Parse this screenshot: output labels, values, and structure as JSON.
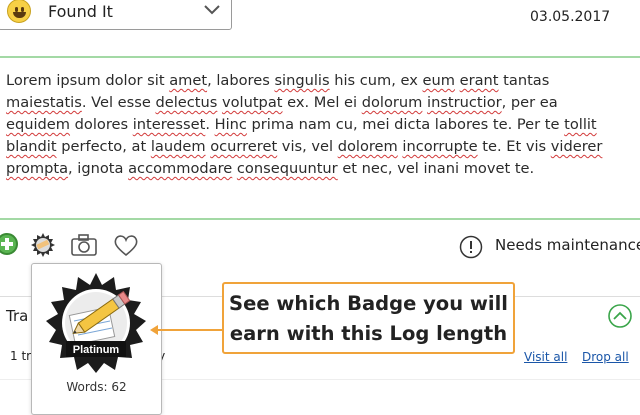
{
  "log_type": {
    "label": "Found It",
    "icon": "smiley-face-icon"
  },
  "date": "03.05.2017",
  "editor": {
    "segments": [
      {
        "t": "Lorem ipsum dolor sit ",
        "sp": false
      },
      {
        "t": "amet",
        "sp": true
      },
      {
        "t": ", labores ",
        "sp": false
      },
      {
        "t": "singulis",
        "sp": true
      },
      {
        "t": " his cum, ex ",
        "sp": false
      },
      {
        "t": "eum",
        "sp": true
      },
      {
        "t": " ",
        "sp": false
      },
      {
        "t": "erant",
        "sp": true
      },
      {
        "t": " tantas ",
        "sp": false
      },
      {
        "t": "maiestatis",
        "sp": true
      },
      {
        "t": ". Vel esse ",
        "sp": false
      },
      {
        "t": "delectus",
        "sp": true
      },
      {
        "t": " ",
        "sp": false
      },
      {
        "t": "volutpat",
        "sp": true
      },
      {
        "t": " ex. Mel ei ",
        "sp": false
      },
      {
        "t": "dolorum",
        "sp": true
      },
      {
        "t": " ",
        "sp": false
      },
      {
        "t": "instructior",
        "sp": true
      },
      {
        "t": ", per ea ",
        "sp": false
      },
      {
        "t": "equidem",
        "sp": true
      },
      {
        "t": " dolores ",
        "sp": false
      },
      {
        "t": "interesset",
        "sp": true
      },
      {
        "t": ". ",
        "sp": false
      },
      {
        "t": "Hinc",
        "sp": true
      },
      {
        "t": " prima nam cu, mei dicta labores te. Per te ",
        "sp": false
      },
      {
        "t": "tollit",
        "sp": true
      },
      {
        "t": " ",
        "sp": false
      },
      {
        "t": "blandit",
        "sp": true
      },
      {
        "t": " perfecto, at ",
        "sp": false
      },
      {
        "t": "laudem",
        "sp": true
      },
      {
        "t": " ",
        "sp": false
      },
      {
        "t": "ocurreret",
        "sp": true
      },
      {
        "t": " vis, vel ",
        "sp": false
      },
      {
        "t": "dolorem",
        "sp": true
      },
      {
        "t": " ",
        "sp": false
      },
      {
        "t": "incorrupte",
        "sp": true
      },
      {
        "t": " te. Et vis ",
        "sp": false
      },
      {
        "t": "viderer",
        "sp": true
      },
      {
        "t": " ",
        "sp": false
      },
      {
        "t": "prompta",
        "sp": true
      },
      {
        "t": ", ignota ",
        "sp": false
      },
      {
        "t": "accommodare",
        "sp": true
      },
      {
        "t": " ",
        "sp": false
      },
      {
        "t": "consequuntur",
        "sp": true
      },
      {
        "t": " et nec, vel inani movet te.",
        "sp": false
      }
    ]
  },
  "toolbar": {
    "icons": [
      "add-icon",
      "badge-icon",
      "camera-icon",
      "heart-icon"
    ],
    "needs_maintenance": "Needs maintenance",
    "alert_icon": "alert-icon"
  },
  "trackables": {
    "title": "Tra",
    "history": "1 tr",
    "history_tail": "tory",
    "visit_all": "Visit all",
    "drop_all": "Drop all",
    "collapse_icon": "chevron-up-circle-icon"
  },
  "badge_popup": {
    "badge_label": "Platinum",
    "words": "Words: 62"
  },
  "callout": {
    "line1": "See which Badge you will",
    "line2": "earn with this Log length",
    "color": "#f0a33a"
  },
  "colors": {
    "accent_green": "#a3d9a5",
    "link": "#1a56a8",
    "callout_border": "#f0a33a"
  }
}
